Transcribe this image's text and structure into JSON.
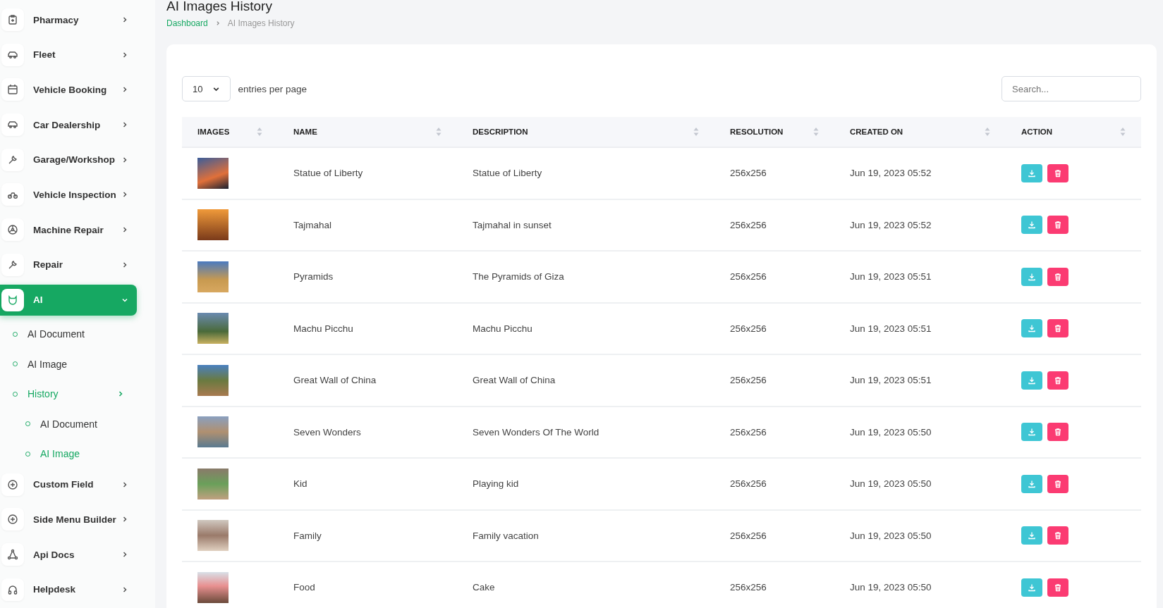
{
  "sidebar": {
    "items": [
      {
        "label": "Pharmacy",
        "expanded": false,
        "selected": false
      },
      {
        "label": "Fleet",
        "expanded": false,
        "selected": false
      },
      {
        "label": "Vehicle Booking",
        "expanded": false,
        "selected": false
      },
      {
        "label": "Car Dealership",
        "expanded": false,
        "selected": false
      },
      {
        "label": "Garage/Workshop",
        "expanded": false,
        "selected": false
      },
      {
        "label": "Vehicle Inspection",
        "expanded": false,
        "selected": false
      },
      {
        "label": "Machine Repair",
        "expanded": false,
        "selected": false
      },
      {
        "label": "Repair",
        "expanded": false,
        "selected": false
      },
      {
        "label": "AI",
        "expanded": true,
        "selected": true,
        "children": [
          {
            "label": "AI Document",
            "selected": false
          },
          {
            "label": "AI Image",
            "selected": false
          },
          {
            "label": "History",
            "selected": true,
            "has_arrow": true,
            "children": [
              {
                "label": "AI Document",
                "selected": false
              },
              {
                "label": "AI Image",
                "selected": true
              }
            ]
          }
        ]
      },
      {
        "label": "Custom Field",
        "expanded": false,
        "selected": false
      },
      {
        "label": "Side Menu Builder",
        "expanded": false,
        "selected": false
      },
      {
        "label": "Api Docs",
        "expanded": false,
        "selected": false
      },
      {
        "label": "Helpdesk",
        "expanded": false,
        "selected": false
      }
    ]
  },
  "page_title": "AI Images History",
  "breadcrumb": [
    "Dashboard",
    "AI Images History"
  ],
  "entries": {
    "value": "10",
    "label": "entries per page"
  },
  "search": {
    "placeholder": "Search..."
  },
  "table": {
    "columns": [
      "IMAGES",
      "NAME",
      "DESCRIPTION",
      "RESOLUTION",
      "CREATED ON",
      "ACTION"
    ],
    "rows": [
      {
        "name": "Statue of Liberty",
        "description": "Statue of Liberty",
        "resolution": "256x256",
        "created_on": "Jun 19, 2023 05:52"
      },
      {
        "name": "Tajmahal",
        "description": "Tajmahal in sunset",
        "resolution": "256x256",
        "created_on": "Jun 19, 2023 05:52"
      },
      {
        "name": "Pyramids",
        "description": "The Pyramids of Giza",
        "resolution": "256x256",
        "created_on": "Jun 19, 2023 05:51"
      },
      {
        "name": "Machu Picchu",
        "description": "Machu Picchu",
        "resolution": "256x256",
        "created_on": "Jun 19, 2023 05:51"
      },
      {
        "name": "Great Wall of China",
        "description": "Great Wall of China",
        "resolution": "256x256",
        "created_on": "Jun 19, 2023 05:51"
      },
      {
        "name": "Seven Wonders",
        "description": "Seven Wonders Of The World",
        "resolution": "256x256",
        "created_on": "Jun 19, 2023 05:50"
      },
      {
        "name": "Kid",
        "description": "Playing kid",
        "resolution": "256x256",
        "created_on": "Jun 19, 2023 05:50"
      },
      {
        "name": "Family",
        "description": "Family vacation",
        "resolution": "256x256",
        "created_on": "Jun 19, 2023 05:50"
      },
      {
        "name": "Food",
        "description": "Cake",
        "resolution": "256x256",
        "created_on": "Jun 19, 2023 05:50"
      }
    ]
  }
}
